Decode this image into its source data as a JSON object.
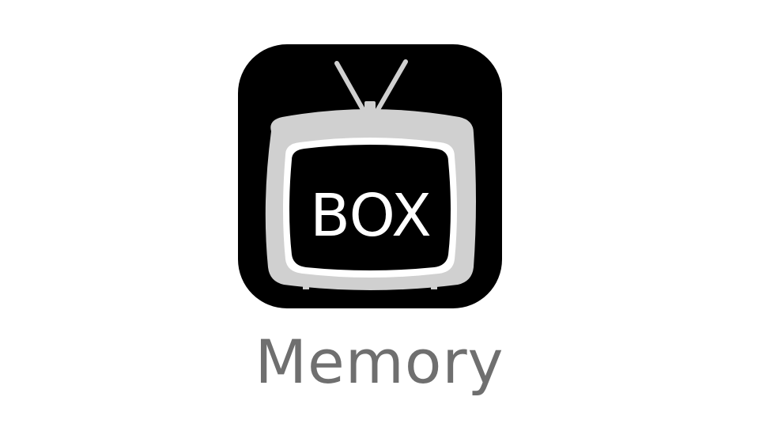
{
  "app": {
    "name": "Memory",
    "icon": {
      "name": "tv-icon",
      "screen_text": "BOX",
      "colors": {
        "background": "#000000",
        "tv_body": "#d0d0d0",
        "tv_frame_inner": "#ffffff",
        "screen": "#000000",
        "screen_text": "#ffffff"
      }
    }
  },
  "colors": {
    "page_background": "#ffffff",
    "label_text": "#6f6f6f"
  }
}
